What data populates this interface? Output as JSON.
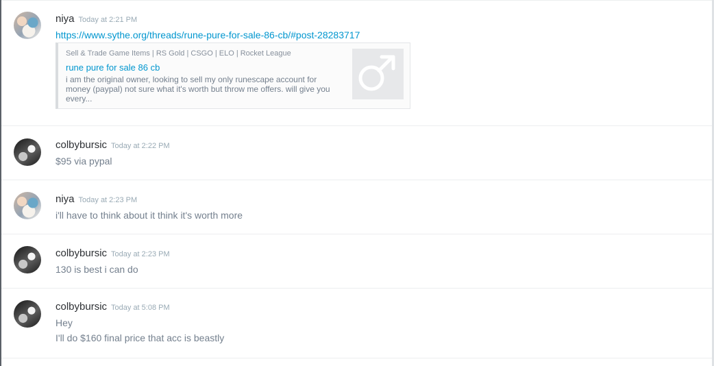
{
  "messages": [
    {
      "author": "niya",
      "timestamp": "Today at 2:21 PM",
      "lines": [
        "https://www.sythe.org/threads/rune-pure-for-sale-86-cb/#post-28283717"
      ],
      "embed": {
        "provider": "Sell & Trade Game Items | RS Gold | CSGO | ELO | Rocket League",
        "title": "rune pure for sale 86 cb",
        "description": "i am the original owner, looking to sell my only runescape account for money (paypal) not sure what it's worth but throw me offers. will give you every..."
      }
    },
    {
      "author": "colbybursic",
      "timestamp": "Today at 2:22 PM",
      "lines": [
        "$95 via pypal"
      ]
    },
    {
      "author": "niya",
      "timestamp": "Today at 2:23 PM",
      "lines": [
        "i'll have to think about it think it's worth more"
      ]
    },
    {
      "author": "colbybursic",
      "timestamp": "Today at 2:23 PM",
      "lines": [
        "130 is best i can do"
      ]
    },
    {
      "author": "colbybursic",
      "timestamp": "Today at 5:08 PM",
      "lines": [
        "Hey",
        "I'll do $160 final price that acc is beastly"
      ]
    }
  ],
  "colors": {
    "link": "#0096cf",
    "username": "#2c2f33",
    "message_text": "#737f8d",
    "timestamp": "#99aab5"
  },
  "icons": {
    "embed_thumbnail": "male-symbol-icon"
  }
}
